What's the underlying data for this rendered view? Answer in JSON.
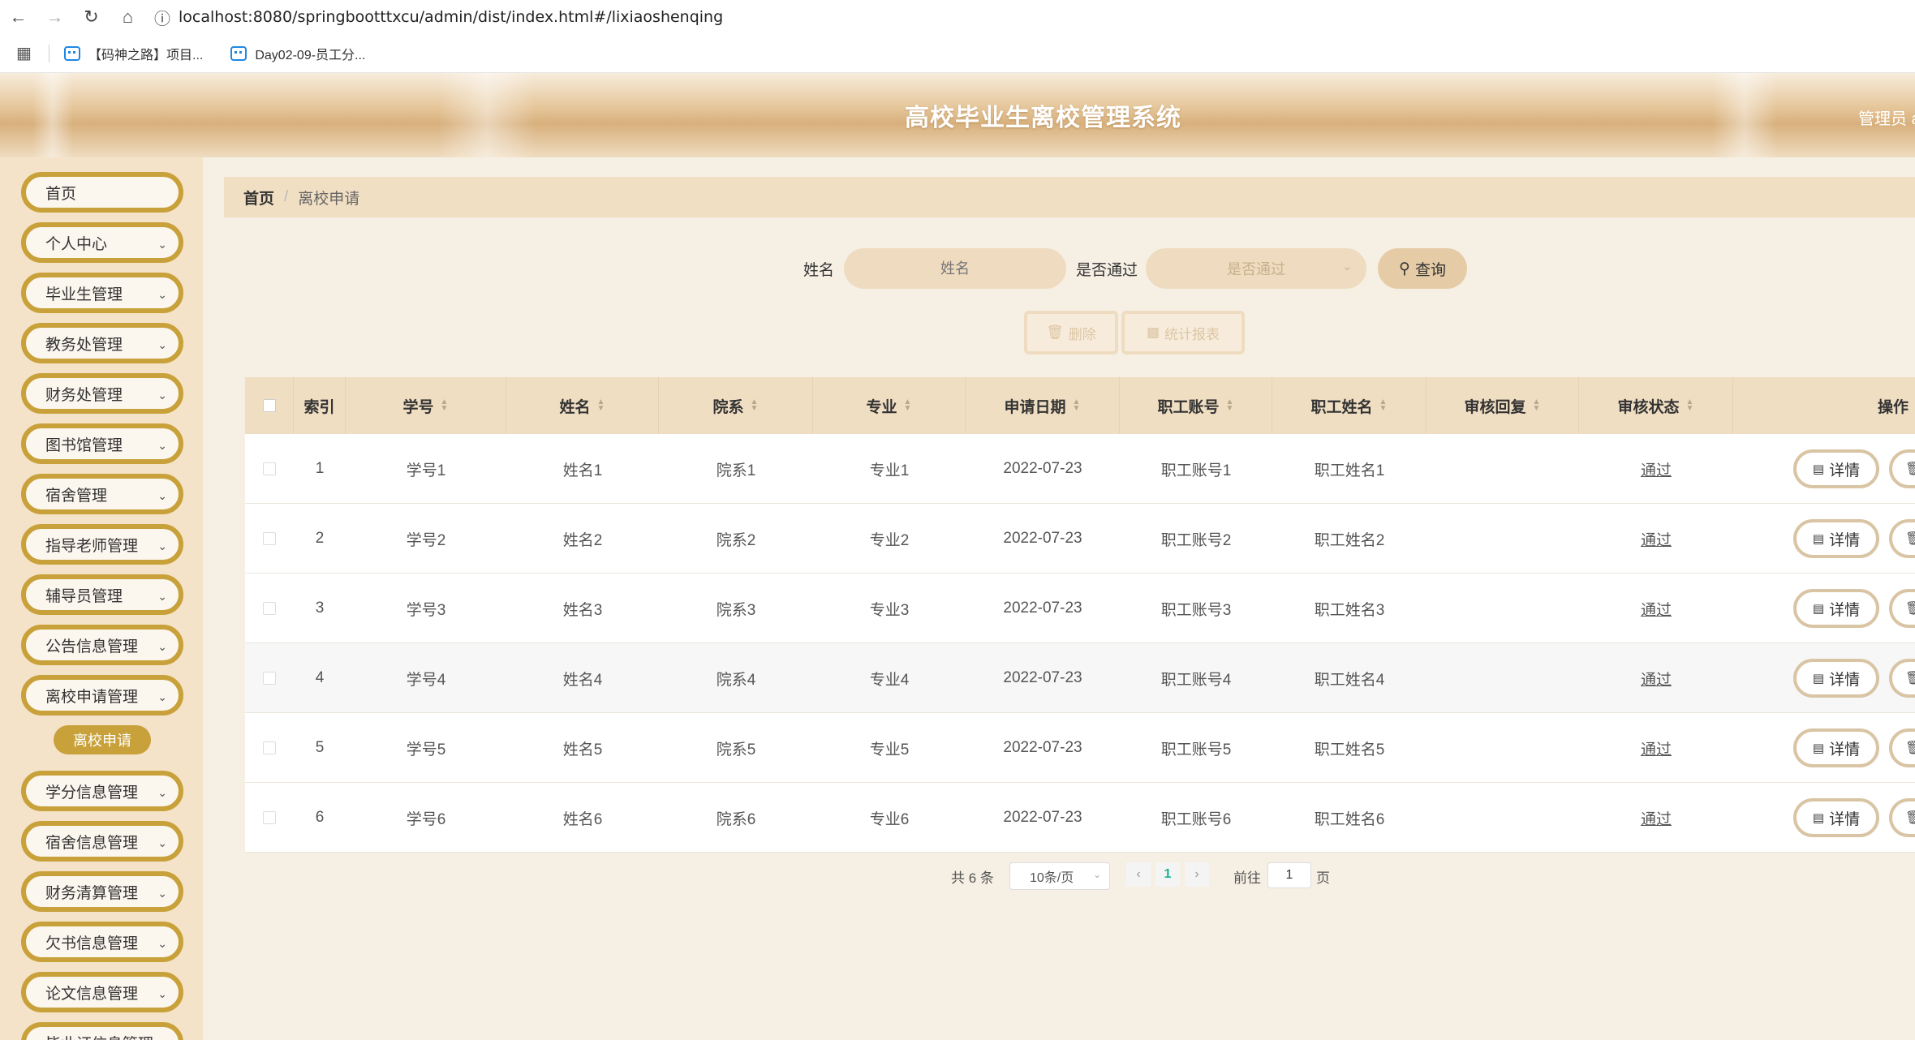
{
  "browser": {
    "url": "localhost:8080/springbootttxcu/admin/dist/index.html#/lixiaoshenqing",
    "bookmarks": [
      "【码神之路】项目...",
      "Day02-09-员工分..."
    ]
  },
  "header": {
    "title": "高校毕业生离校管理系统",
    "user_label": "管理员 a"
  },
  "sidebar": {
    "items": [
      {
        "label": "首页",
        "has_children": false
      },
      {
        "label": "个人中心",
        "has_children": true
      },
      {
        "label": "毕业生管理",
        "has_children": true
      },
      {
        "label": "教务处管理",
        "has_children": true
      },
      {
        "label": "财务处管理",
        "has_children": true
      },
      {
        "label": "图书馆管理",
        "has_children": true
      },
      {
        "label": "宿舍管理",
        "has_children": true
      },
      {
        "label": "指导老师管理",
        "has_children": true
      },
      {
        "label": "辅导员管理",
        "has_children": true
      },
      {
        "label": "公告信息管理",
        "has_children": true
      },
      {
        "label": "离校申请管理",
        "has_children": true
      },
      {
        "label": "学分信息管理",
        "has_children": true
      },
      {
        "label": "宿舍信息管理",
        "has_children": true
      },
      {
        "label": "财务清算管理",
        "has_children": true
      },
      {
        "label": "欠书信息管理",
        "has_children": true
      },
      {
        "label": "论文信息管理",
        "has_children": true
      },
      {
        "label": "毕业证信息管理",
        "has_children": true
      }
    ],
    "active_sub": "离校申请"
  },
  "breadcrumb": {
    "home": "首页",
    "current": "离校申请"
  },
  "search": {
    "name_label": "姓名",
    "name_placeholder": "姓名",
    "pass_label": "是否通过",
    "pass_placeholder": "是否通过",
    "query_label": "查询"
  },
  "actions": {
    "delete_label": "删除",
    "stats_label": "统计报表"
  },
  "table": {
    "columns": [
      "索引",
      "学号",
      "姓名",
      "院系",
      "专业",
      "申请日期",
      "职工账号",
      "职工姓名",
      "审核回复",
      "审核状态",
      "操作"
    ],
    "rows": [
      {
        "index": "1",
        "student_no": "学号1",
        "name": "姓名1",
        "dept": "院系1",
        "major": "专业1",
        "date": "2022-07-23",
        "staff_account": "职工账号1",
        "staff_name": "职工姓名1",
        "reply": "",
        "status": "通过"
      },
      {
        "index": "2",
        "student_no": "学号2",
        "name": "姓名2",
        "dept": "院系2",
        "major": "专业2",
        "date": "2022-07-23",
        "staff_account": "职工账号2",
        "staff_name": "职工姓名2",
        "reply": "",
        "status": "通过"
      },
      {
        "index": "3",
        "student_no": "学号3",
        "name": "姓名3",
        "dept": "院系3",
        "major": "专业3",
        "date": "2022-07-23",
        "staff_account": "职工账号3",
        "staff_name": "职工姓名3",
        "reply": "",
        "status": "通过"
      },
      {
        "index": "4",
        "student_no": "学号4",
        "name": "姓名4",
        "dept": "院系4",
        "major": "专业4",
        "date": "2022-07-23",
        "staff_account": "职工账号4",
        "staff_name": "职工姓名4",
        "reply": "",
        "status": "通过"
      },
      {
        "index": "5",
        "student_no": "学号5",
        "name": "姓名5",
        "dept": "院系5",
        "major": "专业5",
        "date": "2022-07-23",
        "staff_account": "职工账号5",
        "staff_name": "职工姓名5",
        "reply": "",
        "status": "通过"
      },
      {
        "index": "6",
        "student_no": "学号6",
        "name": "姓名6",
        "dept": "院系6",
        "major": "专业6",
        "date": "2022-07-23",
        "staff_account": "职工账号6",
        "staff_name": "职工姓名6",
        "reply": "",
        "status": "通过"
      }
    ],
    "detail_label": "详情"
  },
  "pagination": {
    "total_label": "共 6 条",
    "page_size": "10条/页",
    "current_page": "1",
    "goto_label": "前往",
    "goto_value": "1",
    "page_suffix": "页"
  }
}
